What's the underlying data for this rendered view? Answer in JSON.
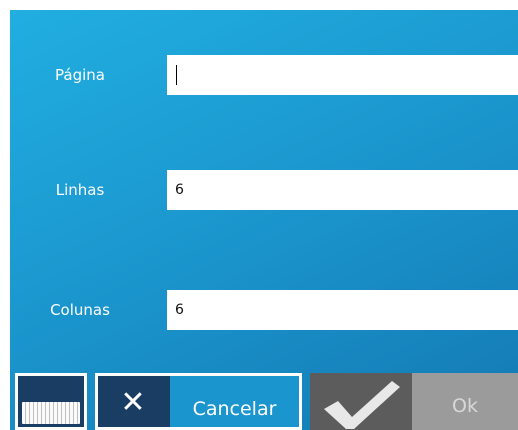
{
  "form": {
    "pagina": {
      "label": "Página",
      "value": ""
    },
    "linhas": {
      "label": "Linhas",
      "value": "6"
    },
    "colunas": {
      "label": "Colunas",
      "value": "6"
    }
  },
  "buttons": {
    "keyboard": {
      "icon": "keyboard-icon"
    },
    "cancel": {
      "icon": "close-icon",
      "label": "Cancelar"
    },
    "ok": {
      "icon": "checkmark-icon",
      "label": "Ok",
      "enabled": false
    }
  },
  "colors": {
    "background_top": "#21aee0",
    "background_bottom": "#1479b4",
    "dark_button": "#1a3d63",
    "disabled_dark": "#5c5c5c",
    "disabled_light": "#9b9b9b"
  }
}
